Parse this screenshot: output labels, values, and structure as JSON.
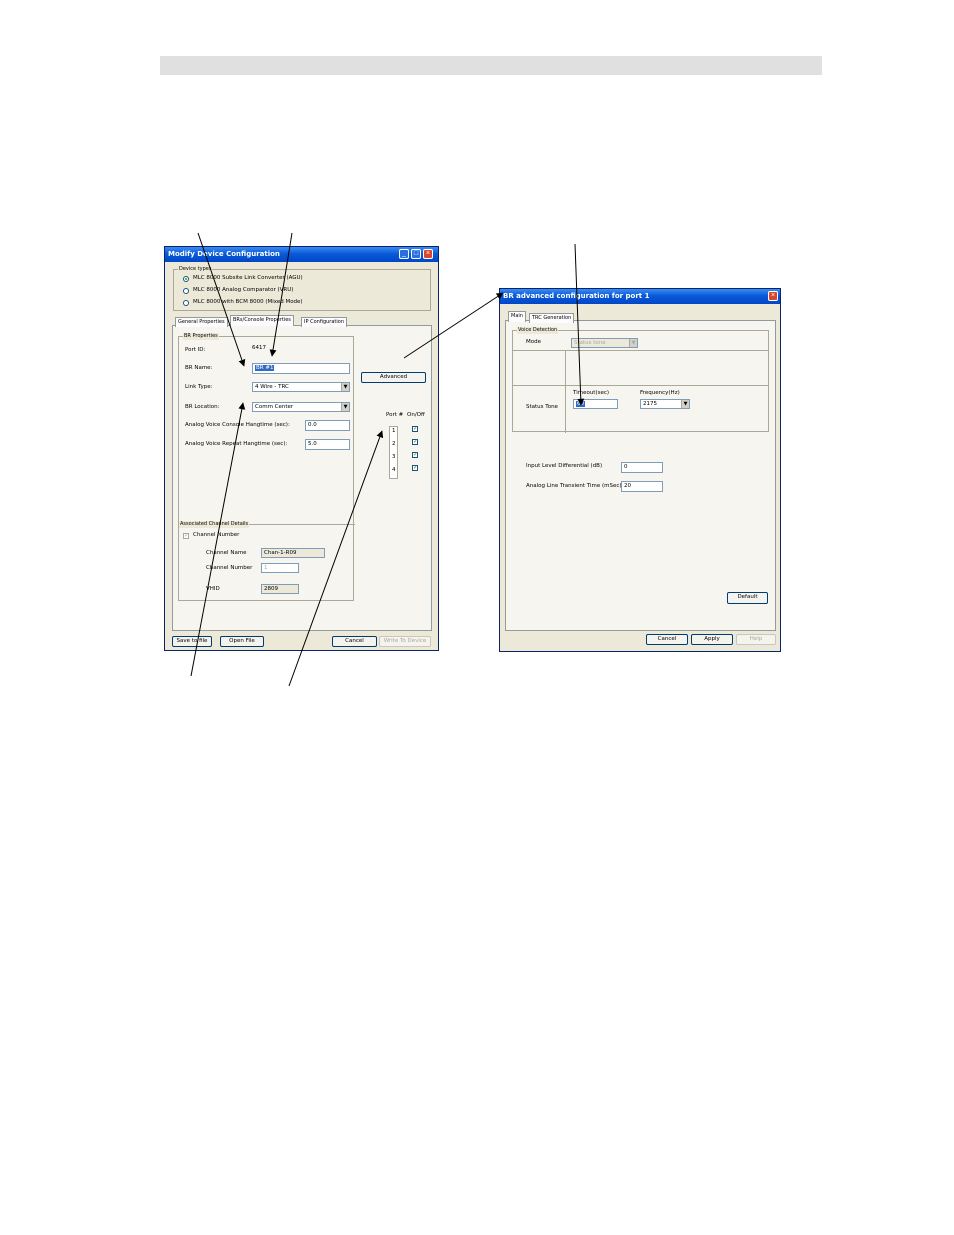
{
  "dialog1": {
    "title": "Modify Device Configuration",
    "device_types_label": "Device types",
    "device_types": [
      {
        "label": "MLC 8000 Subsite Link Converter (AGU)",
        "selected": true
      },
      {
        "label": "MLC 8000 Analog Comparator (VRU)",
        "selected": false
      },
      {
        "label": "MLC 8000 with BCM 8000 (Mixed Mode)",
        "selected": false
      }
    ],
    "tabs": [
      "General Properties",
      "BRs/Console Properties",
      "IP Configuration"
    ],
    "active_tab": "BRs/Console Properties",
    "br_properties_label": "BR Properties",
    "port_id_label": "Port ID:",
    "port_id_value": "6417",
    "br_name_label": "BR Name:",
    "br_name_value": "BR #1",
    "link_type_label": "Link Type:",
    "link_type_value": "4 Wire - TRC",
    "br_location_label": "BR Location:",
    "br_location_value": "Comm Center",
    "console_hangtime_label": "Analog Voice Console Hangtime (sec):",
    "console_hangtime_value": "0.0",
    "repeat_hangtime_label": "Analog Voice Repeat Hangtime (sec):",
    "repeat_hangtime_value": "5.0",
    "advanced_button": "Advanced",
    "port_header": "Port #",
    "onoff_header": "On/Off",
    "ports": [
      "1",
      "2",
      "3",
      "4"
    ],
    "assoc_label": "Associated Channel Details",
    "channel_number_check": "Channel Number",
    "channel_name_label": "Channel Name",
    "channel_name_value": "Chan-1-R09",
    "channel_number_label": "Channel Number",
    "channel_number_value": "1",
    "vidhid_label": "VHID",
    "vidhid_value": "2809",
    "save_button": "Save to file",
    "open_button": "Open File",
    "cancel_button": "Cancel",
    "write_button": "Write To Device"
  },
  "dialog2": {
    "title": "BR advanced configuration for port 1",
    "tabs": [
      "Main",
      "TRC Generation"
    ],
    "voice_detection_label": "Voice Detection",
    "mode_label": "Mode",
    "mode_value": "Status tone",
    "status_tone_label": "Status Tone",
    "timeout_label": "Timeout(sec)",
    "timeout_value": "60",
    "frequency_label": "Frequency(Hz)",
    "frequency_value": "2175",
    "input_level_label": "Input Level Differential (dB)",
    "input_level_value": "0",
    "transient_label": "Analog Line Transient Time (mSec)",
    "transient_value": "20",
    "default_button": "Default",
    "cancel_button": "Cancel",
    "apply_button": "Apply",
    "help_button": "Help"
  },
  "colors": {
    "title_bar": "#0a5ad6",
    "dialog_bg": "#ece9d8",
    "close_button": "#d8462f",
    "check_mark": "#21a121"
  }
}
